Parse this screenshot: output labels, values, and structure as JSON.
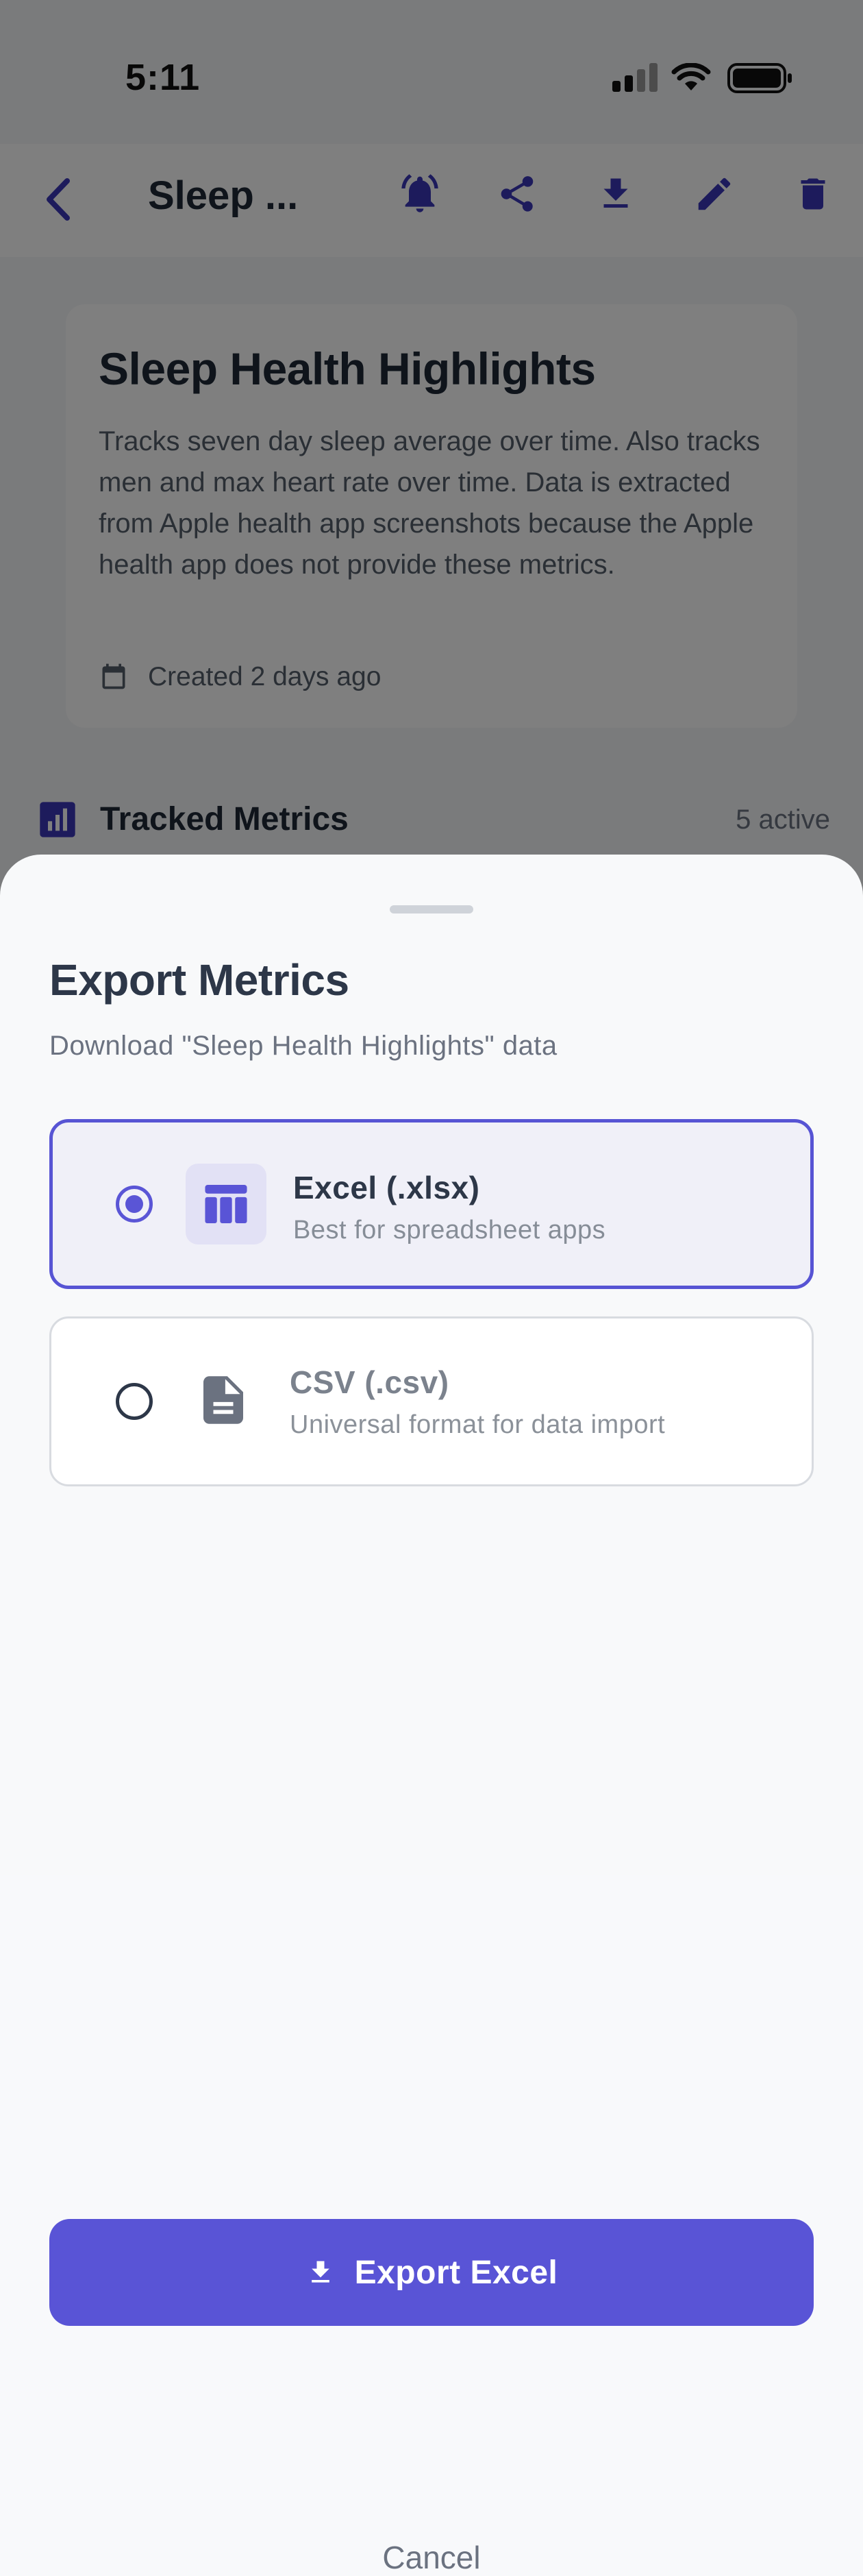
{
  "status_bar": {
    "time": "5:11"
  },
  "header": {
    "title": "Sleep ..."
  },
  "card": {
    "title": "Sleep Health Highlights",
    "description": "Tracks seven day sleep average over time. Also tracks men and max heart rate over time. Data is extracted from Apple health app screenshots because the Apple health app does not provide these metrics.",
    "created": "Created 2 days ago"
  },
  "tracked": {
    "label": "Tracked Metrics",
    "count": "5 active"
  },
  "sheet": {
    "title": "Export Metrics",
    "subtitle": "Download \"Sleep Health Highlights\" data",
    "options": [
      {
        "title": "Excel (.xlsx)",
        "subtitle": "Best for spreadsheet apps",
        "selected": true
      },
      {
        "title": "CSV (.csv)",
        "subtitle": "Universal format for data import",
        "selected": false
      }
    ],
    "export_label": "Export Excel",
    "cancel_label": "Cancel"
  },
  "colors": {
    "accent": "#5954d6",
    "text_dark": "#2d3748",
    "text_muted": "#6b7280"
  },
  "icons": [
    "back-chevron",
    "bell-icon",
    "share-icon",
    "download-icon",
    "edit-icon",
    "trash-icon",
    "calendar-icon",
    "bar-chart-icon",
    "table-icon",
    "document-icon"
  ]
}
